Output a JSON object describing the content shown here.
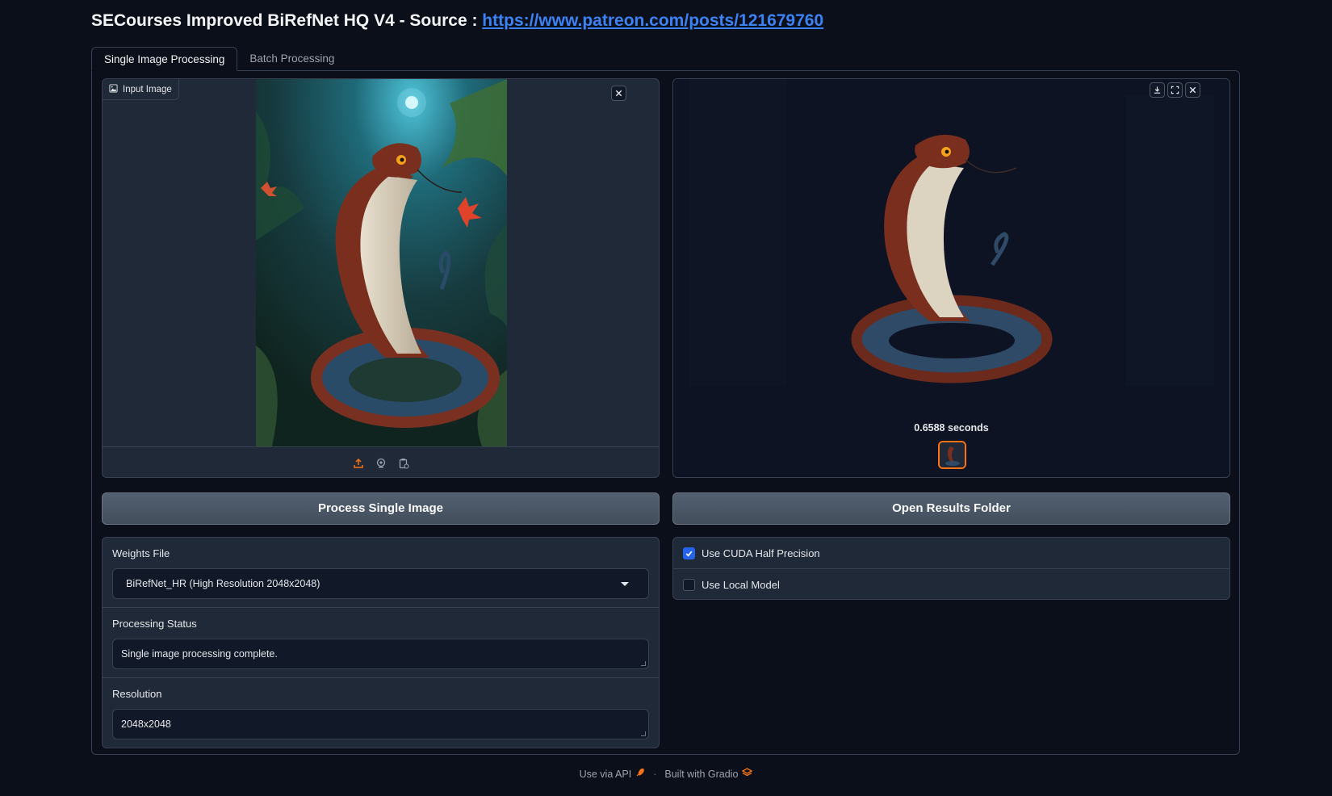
{
  "header": {
    "title_prefix": "SECourses Improved BiRefNet HQ V4 - Source : ",
    "source_link": "https://www.patreon.com/posts/121679760"
  },
  "tabs": [
    {
      "label": "Single Image Processing",
      "active": true
    },
    {
      "label": "Batch Processing",
      "active": false
    }
  ],
  "input_image": {
    "label": "Input Image",
    "icons": [
      "image-icon",
      "close-icon",
      "upload-icon",
      "webcam-icon",
      "clipboard-icon"
    ]
  },
  "output_image": {
    "caption": "0.6588 seconds",
    "icons": [
      "download-icon",
      "fullscreen-icon",
      "close-icon"
    ]
  },
  "buttons": {
    "process": "Process Single Image",
    "open_folder": "Open Results Folder"
  },
  "weights": {
    "label": "Weights File",
    "selected": "BiRefNet_HR (High Resolution 2048x2048)"
  },
  "status": {
    "label": "Processing Status",
    "value": "Single image processing complete."
  },
  "resolution": {
    "label": "Resolution",
    "value": "2048x2048"
  },
  "options": {
    "cuda_half": {
      "label": "Use CUDA Half Precision",
      "checked": true
    },
    "local_model": {
      "label": "Use Local Model",
      "checked": false
    }
  },
  "footer": {
    "api": "Use via API",
    "separator": "·",
    "built": "Built with Gradio"
  },
  "colors": {
    "background": "#0b0f19",
    "panel": "#1f2937",
    "link": "#3b82f6",
    "accent": "#f97316",
    "checkbox": "#2563eb"
  }
}
